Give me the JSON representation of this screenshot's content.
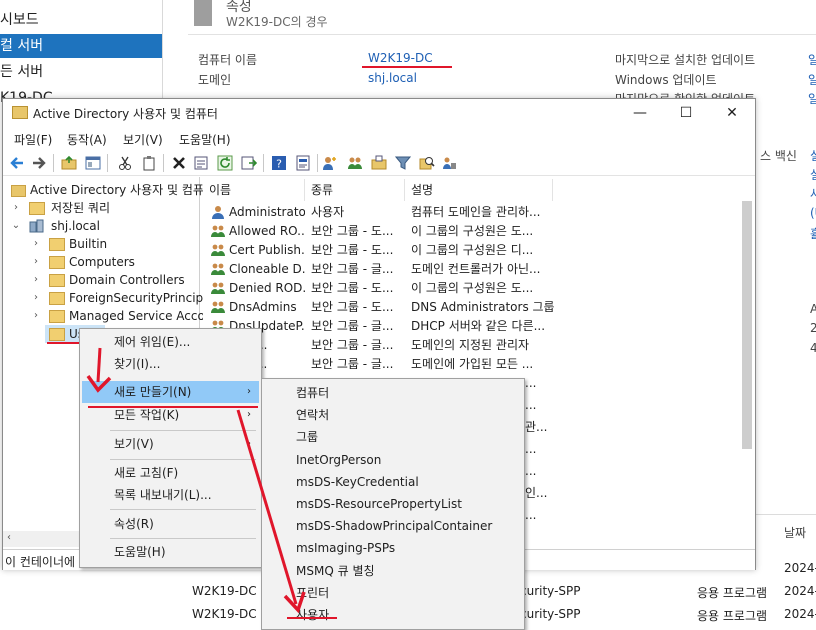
{
  "bg_nav": {
    "items": [
      "시보드",
      "컬 서버",
      "든 서버",
      "K19-DC"
    ],
    "selected": 1
  },
  "bg_props": {
    "heading": "속성",
    "subtitle": "W2K19-DC의 경우",
    "computer_name_label": "컴퓨터 이름",
    "computer_name_value": "W2K19-DC",
    "domain_label": "도메인",
    "domain_value": "shj.local",
    "last_update_label": "마지막으로 설치한 업데이트",
    "windows_update_label": "Windows 업데이트",
    "last_check_label": "마지막으로 확인한 업데이트",
    "right_partial": [
      "일",
      "일",
      "일"
    ]
  },
  "right_strip": [
    "스 백신",
    "실",
    "설",
    "사",
    "(U",
    "휼",
    "A",
    "2",
    "4",
    "날짜",
    "2024-0",
    "2024-0",
    "2024-0"
  ],
  "events": [
    {
      "server": "W2K19-DC",
      "source": "curity-SPP",
      "log": "응용 프로그램",
      "date": "2024-0"
    },
    {
      "server": "W2K19-DC",
      "source": "curity-SPP",
      "log": "응용 프로그램",
      "date": "2024-0"
    }
  ],
  "window": {
    "title": "Active Directory 사용자 및 컴퓨터",
    "min": "—",
    "max": "☐",
    "close": "✕",
    "menus": [
      "파일(F)",
      "동작(A)",
      "보기(V)",
      "도움말(H)"
    ]
  },
  "tree": {
    "root": "Active Directory 사용자 및 컴퓨터",
    "saved_queries": "저장된 쿼리",
    "domain": "shj.local",
    "children": [
      "Builtin",
      "Computers",
      "Domain Controllers",
      "ForeignSecurityPrincipal",
      "Managed Service Accou",
      "Us"
    ]
  },
  "list": {
    "headers": [
      "이름",
      "종류",
      "설명"
    ],
    "rows": [
      {
        "name": "Administrator",
        "type": "사용자",
        "desc": "컴퓨터 도메인을 관리하..."
      },
      {
        "name": "Allowed RO...",
        "type": "보안 그룹 - 도...",
        "desc": "이 그룹의 구성원은 도..."
      },
      {
        "name": "Cert Publish...",
        "type": "보안 그룹 - 도...",
        "desc": "이 그룹의 구성원은 디..."
      },
      {
        "name": "Cloneable D...",
        "type": "보안 그룹 - 글...",
        "desc": "도메인 컨트롤러가 아닌..."
      },
      {
        "name": "Denied ROD...",
        "type": "보안 그룹 - 도...",
        "desc": "이 그룹의 구성원은 도..."
      },
      {
        "name": "DnsAdmins",
        "type": "보안 그룹 - 도...",
        "desc": "DNS Administrators 그룹"
      },
      {
        "name": "DnsUpdateP...",
        "type": "보안 그룹 - 글...",
        "desc": "DHCP 서버와 같은 다른..."
      },
      {
        "name": "n Ad...",
        "type": "보안 그룹 - 글...",
        "desc": "도메인의 지정된 관리자"
      },
      {
        "name": "n Co...",
        "type": "보안 그룹 - 글...",
        "desc": "도메인에 가입된 모든 ..."
      }
    ],
    "partial_desc": [
      "...",
      "...",
      "관...",
      "...",
      "...",
      "인...",
      "..."
    ]
  },
  "status": "이 컨테이너에",
  "context_menu": {
    "items": [
      "제어 위임(E)...",
      "찾기(I)...",
      "새로 만들기(N)",
      "모든 작업(K)",
      "보기(V)",
      "새로 고침(F)",
      "목록 내보내기(L)...",
      "속성(R)",
      "도움말(H)"
    ]
  },
  "submenu": {
    "items": [
      "컴퓨터",
      "연락처",
      "그룹",
      "InetOrgPerson",
      "msDS-KeyCredential",
      "msDS-ResourcePropertyList",
      "msDS-ShadowPrincipalContainer",
      "msImaging-PSPs",
      "MSMQ 큐 별칭",
      "프린터",
      "사용자"
    ]
  },
  "colors": {
    "accent": "#1e73be",
    "annotation": "#e0162b",
    "highlight": "#91c9f7"
  }
}
